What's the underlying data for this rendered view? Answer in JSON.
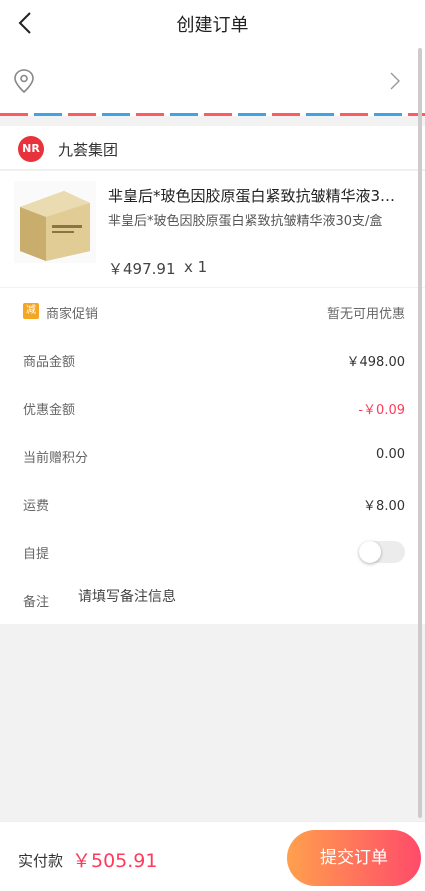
{
  "header": {
    "title": "创建订单"
  },
  "address": {},
  "shop": {
    "logo_text": "NR",
    "name": "九荟集团"
  },
  "product": {
    "title": "芈皇后*玻色因胶原蛋白紧致抗皱精华液30支/盒",
    "desc": "芈皇后*玻色因胶原蛋白紧致抗皱精华液30支/盒",
    "price": "￥497.91",
    "qty": "x 1"
  },
  "details": {
    "promo_icon": "减",
    "promo_label": "商家促销",
    "promo_value": "暂无可用优惠",
    "goods_label": "商品金额",
    "goods_value": "￥498.00",
    "discount_label": "优惠金额",
    "discount_value": "-￥0.09",
    "points_label": "当前赠积分",
    "points_value": "0.00",
    "shipping_label": "运费",
    "shipping_value": "￥8.00",
    "pickup_label": "自提",
    "pickup_enabled": false,
    "remark_label": "备注",
    "remark_placeholder": "请填写备注信息"
  },
  "footer": {
    "pay_label": "实付款",
    "pay_amount": "￥505.91",
    "submit_label": "提交订单"
  },
  "colors": {
    "accent": "#ff3b5c",
    "brand": "#e8323c",
    "button_start": "#ffa04d",
    "button_end": "#ff4b6a"
  }
}
